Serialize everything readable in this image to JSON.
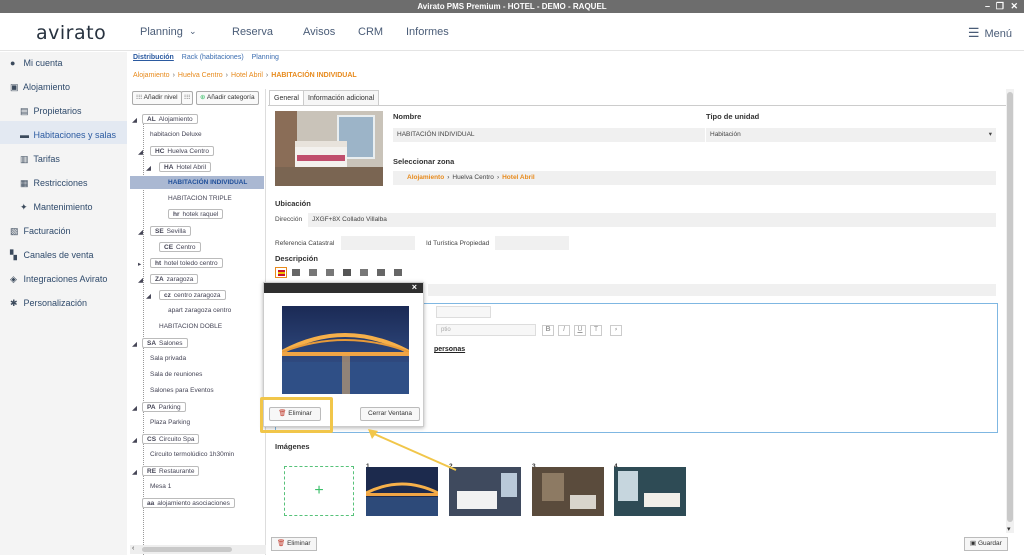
{
  "window": {
    "title": "Avirato PMS Premium - HOTEL - DEMO - RAQUEL"
  },
  "brand": {
    "logo": "avirato"
  },
  "topnav": {
    "items": [
      "Planning",
      "Reserva",
      "Avisos",
      "CRM",
      "Informes"
    ],
    "menu_label": "Menú"
  },
  "sidebar": {
    "items": [
      {
        "label": "Mi cuenta",
        "icon": "user-icon"
      },
      {
        "label": "Alojamiento",
        "icon": "building-icon"
      },
      {
        "label": "Propietarios",
        "icon": "id-icon"
      },
      {
        "label": "Habitaciones y salas",
        "icon": "bed-icon"
      },
      {
        "label": "Tarifas",
        "icon": "document-icon"
      },
      {
        "label": "Restricciones",
        "icon": "calendar-icon"
      },
      {
        "label": "Mantenimiento",
        "icon": "sparkle-icon"
      },
      {
        "label": "Facturación",
        "icon": "invoice-icon"
      },
      {
        "label": "Canales de venta",
        "icon": "grid-icon"
      },
      {
        "label": "Integraciones Avirato",
        "icon": "layers-icon"
      },
      {
        "label": "Personalización",
        "icon": "gear-icon"
      }
    ]
  },
  "subtabs": [
    "Distribución",
    "Rack (habitaciones)",
    "Planning"
  ],
  "breadcrumb": [
    "Alojamiento",
    "Huelva Centro",
    "Hotel Abril",
    "HABITACIÓN INDIVIDUAL"
  ],
  "tree": {
    "add_level": "Añadir nivel",
    "add_category": "Añadir categoría",
    "nodes": [
      {
        "abbr": "AL",
        "label": "Alojamiento"
      },
      {
        "abbr": "",
        "label": "habitacion Deluxe"
      },
      {
        "abbr": "HC",
        "label": "Huelva Centro"
      },
      {
        "abbr": "HA",
        "label": "Hotel Abril"
      },
      {
        "abbr": "",
        "label": "HABITACIÓN INDIVIDUAL"
      },
      {
        "abbr": "",
        "label": "HABITACION TRIPLE"
      },
      {
        "abbr": "hr",
        "label": "hotek raquel"
      },
      {
        "abbr": "SE",
        "label": "Sevilla"
      },
      {
        "abbr": "CE",
        "label": "Centro"
      },
      {
        "abbr": "ht",
        "label": "hotel toledo centro"
      },
      {
        "abbr": "ZA",
        "label": "zaragoza"
      },
      {
        "abbr": "cz",
        "label": "centro zaragoza"
      },
      {
        "abbr": "",
        "label": "apart zaragoza centro"
      },
      {
        "abbr": "",
        "label": "HABITACION DOBLE"
      },
      {
        "abbr": "SA",
        "label": "Salones"
      },
      {
        "abbr": "",
        "label": "Sala privada"
      },
      {
        "abbr": "",
        "label": "Sala de reuniones"
      },
      {
        "abbr": "",
        "label": "Salones para Eventos"
      },
      {
        "abbr": "PA",
        "label": "Parking"
      },
      {
        "abbr": "",
        "label": "Plaza Parking"
      },
      {
        "abbr": "CS",
        "label": "Circuito Spa"
      },
      {
        "abbr": "",
        "label": "Circuito termolúdico 1h30min"
      },
      {
        "abbr": "RE",
        "label": "Restaurante"
      },
      {
        "abbr": "",
        "label": "Mesa 1"
      },
      {
        "abbr": "aa",
        "label": "alojamiento asociaciones"
      }
    ]
  },
  "form": {
    "tabs": [
      "General",
      "Información adicional"
    ],
    "nombre_label": "Nombre",
    "nombre_value": "HABITACIÓN INDIVIDUAL",
    "tipo_label": "Tipo de unidad",
    "tipo_value": "Habitación",
    "zona_label": "Seleccionar zona",
    "zona_path": [
      "Alojamiento",
      "Huelva Centro",
      "Hotel Abril"
    ],
    "ubicacion_label": "Ubicación",
    "direccion_label": "Dirección",
    "direccion_value": "JXGF+8X Collado Villalba",
    "ref_catastral_label": "Referencia Catastral",
    "id_turistica_label": "Id Turística Propiedad",
    "descripcion_label": "Descripción",
    "editor_text": "personas",
    "editor_font_placeholder": "ptio"
  },
  "modal": {
    "delete_label": "Eliminar",
    "close_label": "Cerrar Ventana",
    "close_x": "×"
  },
  "images": {
    "label": "Imágenes",
    "add": "+",
    "numbers": [
      "1",
      "2",
      "3",
      "4"
    ]
  },
  "footer": {
    "delete_label": "Eliminar",
    "save_label": "Guardar"
  }
}
